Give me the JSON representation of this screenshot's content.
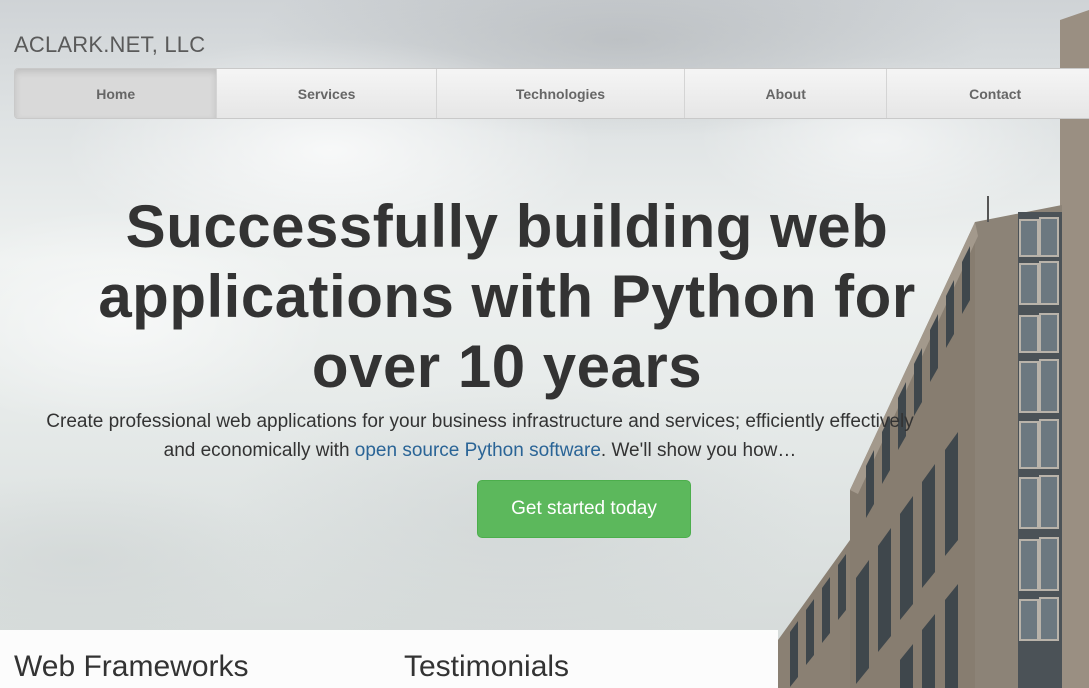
{
  "brand": "ACLARK.NET, LLC",
  "nav": {
    "items": [
      {
        "label": "Home",
        "active": true
      },
      {
        "label": "Services",
        "active": false
      },
      {
        "label": "Technologies",
        "active": false
      },
      {
        "label": "About",
        "active": false
      },
      {
        "label": "Contact",
        "active": false
      }
    ]
  },
  "hero": {
    "title": "Successfully building web applications with Python for over 10 years",
    "lead_before": "Create professional web applications for your business infrastructure and services; efficiently effectively and economically with ",
    "lead_link": "open source Python software",
    "lead_after": ". We'll show you how…",
    "cta_label": "Get started today"
  },
  "sections": {
    "web_frameworks": "Web Frameworks",
    "testimonials": "Testimonials"
  },
  "colors": {
    "cta_green": "#5cb85c",
    "link_blue": "#2a6496",
    "text_dark": "#333333"
  }
}
